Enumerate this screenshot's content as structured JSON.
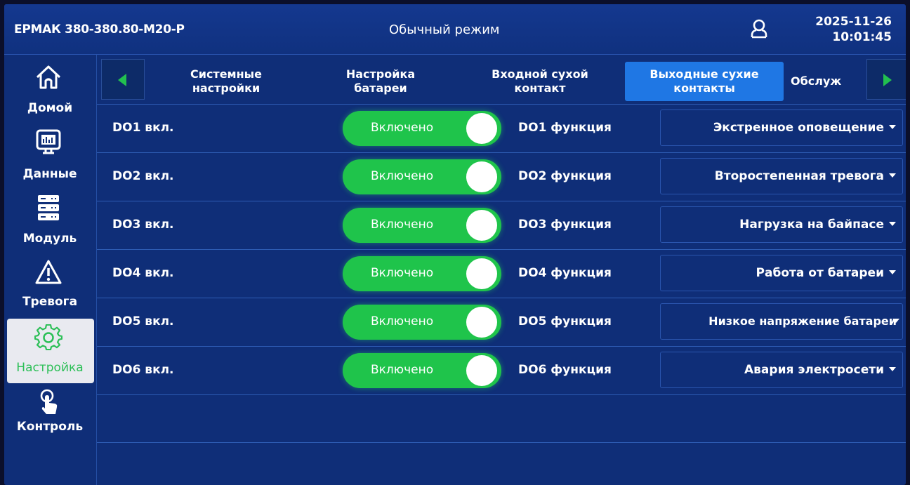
{
  "header": {
    "device_name": "ЕРМАК 380-380.80-M20-P",
    "mode": "Обычный режим",
    "date": "2025-11-26",
    "time": "10:01:45"
  },
  "sidebar": {
    "items": [
      {
        "label": "Домой",
        "icon": "home-icon"
      },
      {
        "label": "Данные",
        "icon": "monitor-chart-icon"
      },
      {
        "label": "Модуль",
        "icon": "server-module-icon"
      },
      {
        "label": "Тревога",
        "icon": "warning-icon"
      },
      {
        "label": "Настройка",
        "icon": "gear-icon",
        "active": true
      },
      {
        "label": "Контроль",
        "icon": "hand-pointer-icon"
      }
    ]
  },
  "tabs": [
    {
      "label": "Системные\nнастройки"
    },
    {
      "label": "Настройка\nбатареи"
    },
    {
      "label": "Входной сухой\nконтакт"
    },
    {
      "label": "Выходные сухие\nконтакты",
      "active": true
    },
    {
      "label": "Обслуж"
    }
  ],
  "rows": [
    {
      "label": "DO1 вкл.",
      "toggle": "Включено",
      "func_label": "DO1 функция",
      "value": "Экстренное оповещение"
    },
    {
      "label": "DO2 вкл.",
      "toggle": "Включено",
      "func_label": "DO2 функция",
      "value": "Второстепенная тревога"
    },
    {
      "label": "DO3 вкл.",
      "toggle": "Включено",
      "func_label": "DO3 функция",
      "value": "Нагрузка на байпасе"
    },
    {
      "label": "DO4 вкл.",
      "toggle": "Включено",
      "func_label": "DO4 функция",
      "value": "Работа от батареи"
    },
    {
      "label": "DO5 вкл.",
      "toggle": "Включено",
      "func_label": "DO5 функция",
      "value": "Низкое напряжение батареи"
    },
    {
      "label": "DO6 вкл.",
      "toggle": "Включено",
      "func_label": "DO6 функция",
      "value": "Авария электросети"
    }
  ],
  "colors": {
    "background": "#0f2e78",
    "toggle_on": "#1fc44b",
    "active_tab": "#1f77e4",
    "active_nav_bg": "#e9eaf0",
    "active_nav_text": "#2bbf56",
    "arrow": "#22c04f"
  }
}
